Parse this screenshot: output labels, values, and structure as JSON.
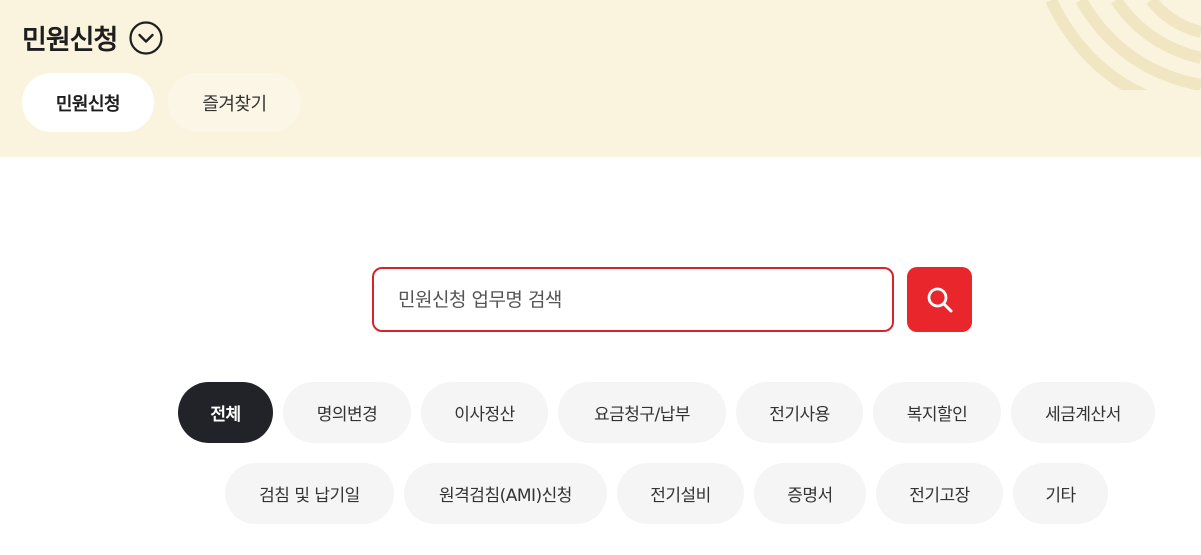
{
  "header": {
    "title": "민원신청",
    "tabs": [
      {
        "label": "민원신청"
      },
      {
        "label": "즐겨찾기"
      }
    ]
  },
  "search": {
    "placeholder": "민원신청 업무명 검색",
    "value": ""
  },
  "categories": [
    {
      "label": "전체",
      "active": true
    },
    {
      "label": "명의변경"
    },
    {
      "label": "이사정산"
    },
    {
      "label": "요금청구/납부"
    },
    {
      "label": "전기사용"
    },
    {
      "label": "복지할인"
    },
    {
      "label": "세금계산서"
    },
    {
      "label": "검침 및 납기일"
    },
    {
      "label": "원격검침(AMI)신청"
    },
    {
      "label": "전기설비"
    },
    {
      "label": "증명서"
    },
    {
      "label": "전기고장"
    },
    {
      "label": "기타"
    }
  ],
  "colors": {
    "header_bg": "#faf4de",
    "accent_red": "#e8262b",
    "active_chip": "#222329",
    "chip_bg": "#f5f5f5"
  }
}
